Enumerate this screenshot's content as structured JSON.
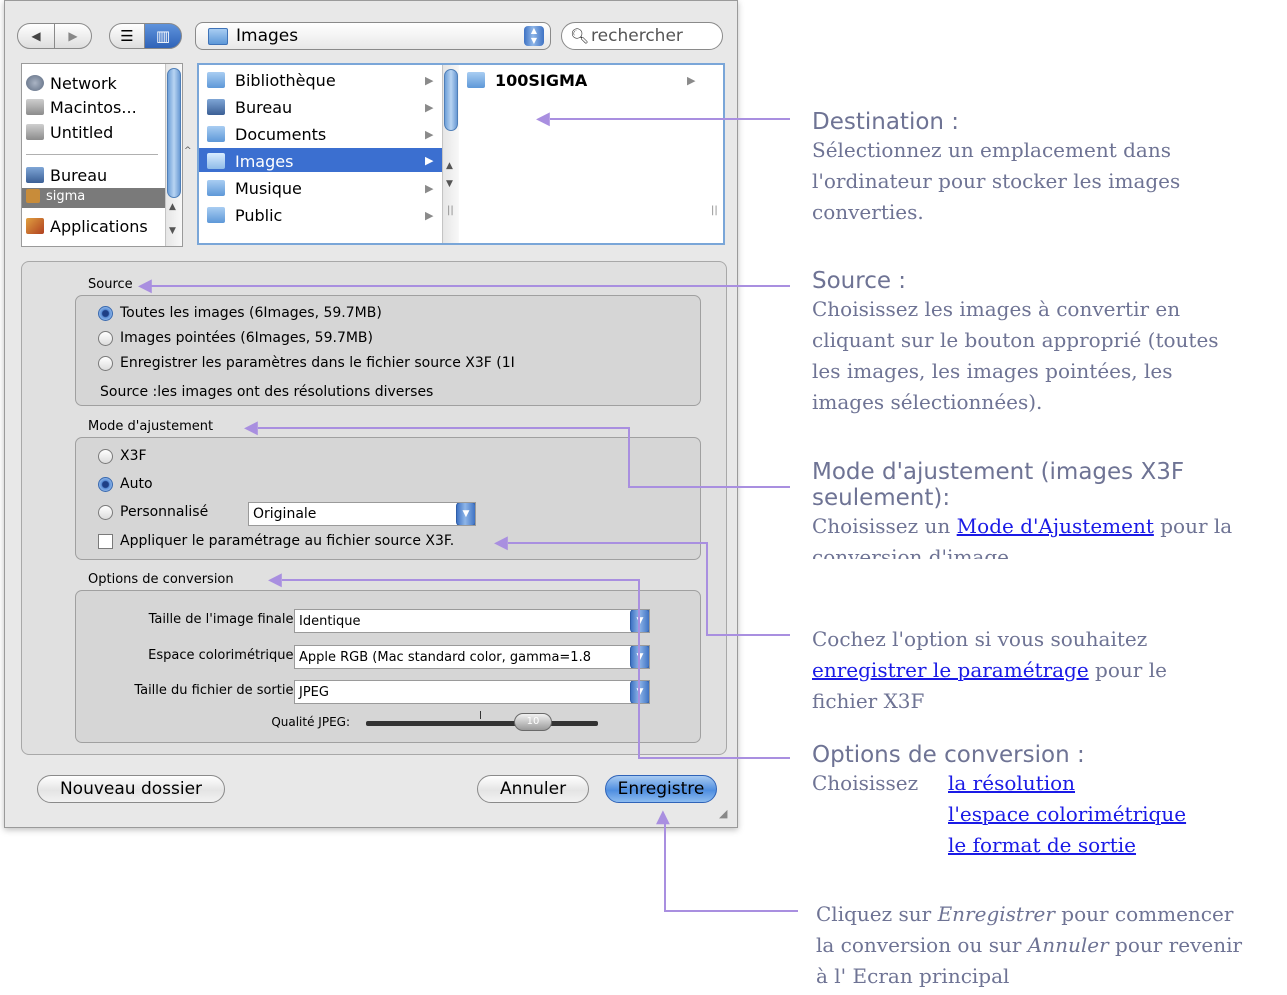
{
  "toolbar": {
    "back_glyph": "◀",
    "forward_glyph": "▶",
    "list_view_glyph": "☰",
    "column_view_glyph": "▥",
    "location": "Images",
    "search_placeholder": "rechercher"
  },
  "sidebar": {
    "items": [
      {
        "label": "Network",
        "icon": "network-icon"
      },
      {
        "label": "Macintos...",
        "icon": "hard-disk-icon"
      },
      {
        "label": "Untitled",
        "icon": "hard-disk-icon"
      },
      {
        "label": "Bureau",
        "icon": "desktop-icon"
      },
      {
        "label": "sigma",
        "icon": "home-icon",
        "selected": true
      },
      {
        "label": "Applications",
        "icon": "applications-icon"
      }
    ]
  },
  "browser": {
    "column1": [
      "Bibliothèque",
      "Bureau",
      "Documents",
      "Images",
      "Musique",
      "Public"
    ],
    "column1_selected": "Images",
    "column2": [
      "100SIGMA"
    ]
  },
  "source": {
    "label": "Source",
    "options": [
      {
        "label": "Toutes les images (6Images, 59.7MB)",
        "selected": true
      },
      {
        "label": "Images pointées (6Images, 59.7MB)",
        "selected": false
      },
      {
        "label": "Enregistrer les paramètres dans le fichier source  X3F (1I",
        "selected": false
      }
    ],
    "note": "Source :les images ont des résolutions diverses"
  },
  "adjust": {
    "label": "Mode d'ajustement",
    "options": [
      {
        "label": "X3F",
        "selected": false
      },
      {
        "label": "Auto",
        "selected": true
      },
      {
        "label": "Personnalisé",
        "selected": false
      }
    ],
    "custom_value": "Originale",
    "apply_checkbox": "Appliquer le paramétrage au fichier source X3F."
  },
  "conversion": {
    "label": "Options de conversion",
    "size_label": "Taille de l'image finale :",
    "size_value": "Identique",
    "space_label": "Espace colorimétrique :",
    "space_value": "Apple RGB (Mac standard color, gamma=1.8",
    "format_label": "Taille du fichier de sortie :",
    "format_value": "JPEG",
    "quality_label": "Qualité JPEG:",
    "quality_value": "10"
  },
  "buttons": {
    "new_folder": "Nouveau dossier",
    "cancel": "Annuler",
    "save": "Enregistre"
  },
  "annotations": {
    "destination_title": "Destination :",
    "destination_body": [
      "Sélectionnez un emplacement dans",
      "l'ordinateur pour stocker les images",
      "converties."
    ],
    "source_title": "Source :",
    "source_body": [
      "Choisissez les images à convertir en",
      "cliquant sur le bouton approprié (toutes",
      "les images, les images pointées, les",
      "images sélectionnées)."
    ],
    "mode_title": [
      "Mode d'ajustement (images X3F",
      "seulement):"
    ],
    "mode_body_prefix": "Choisissez un ",
    "mode_body_link": " Mode d'Ajustement",
    "mode_body_suffix": " pour la",
    "mode_body_line2": "conversion d'image.",
    "check_line1": "Cochez l'option si vous souhaitez",
    "check_link": "enregistrer le paramétrage",
    "check_line2_suffix": " pour le",
    "check_line3": "fichier X3F",
    "options_title": "Options de conversion :",
    "options_prefix": "Choisissez",
    "options_links": [
      "la résolution",
      "l'espace colorimétrique",
      "le format de sortie"
    ],
    "save_line1_prefix": "Cliquez sur ",
    "save_line1_italic": "Enregistrer",
    "save_line1_suffix": " pour commencer",
    "save_line2_prefix": "la conversion ou sur ",
    "save_line2_italic": "Annuler",
    "save_line2_suffix": " pour revenir",
    "save_line3": "à l' Ecran principal"
  },
  "colors": {
    "accent_blue": "#3f73c4",
    "selection_blue": "#3b6fd0",
    "annotation_text": "#6e7394",
    "callout_line": "#a98fe0",
    "link": "#1a1ae6"
  }
}
